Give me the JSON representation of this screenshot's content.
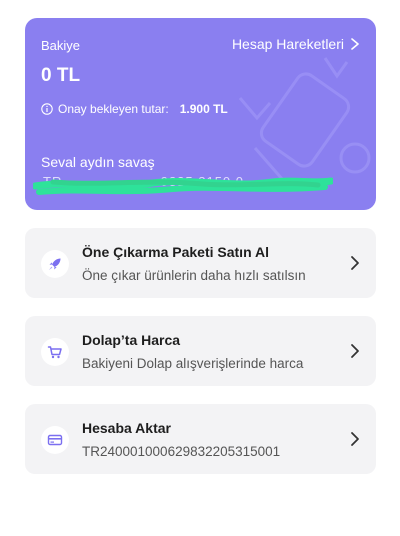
{
  "card": {
    "balance_label": "Bakiye",
    "history_link": "Hesap Hareketleri",
    "balance_amount": "0 TL",
    "pending_label": "Onay bekleyen tutar:",
    "pending_amount": "1.900 TL",
    "owner_name": "Seval  aydın savaş",
    "iban_redacted": "TR  ·····  ·····  ·····  9835 8150 0",
    "bg_color": "#8a7ff0",
    "redaction_color": "#2ee29a"
  },
  "options": [
    {
      "title": "Öne Çıkarma Paketi Satın Al",
      "subtitle": "Öne çıkar ürünlerin daha hızlı satılsın",
      "icon": "rocket-icon"
    },
    {
      "title": "Dolap’ta Harca",
      "subtitle": "Bakiyeni Dolap alışverişlerinde harca",
      "icon": "cart-icon"
    },
    {
      "title": "Hesaba Aktar",
      "subtitle": "TR240001000629832205315001",
      "icon": "card-icon"
    }
  ],
  "accent_color": "#7b6ff0"
}
